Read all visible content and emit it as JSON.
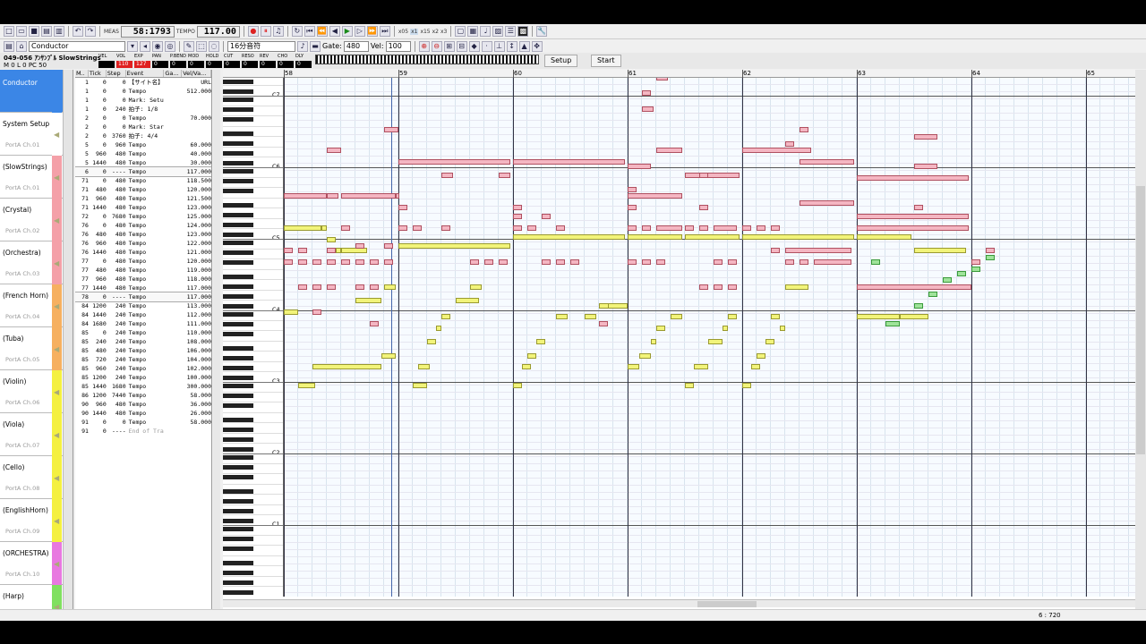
{
  "toolbar": {
    "meas_label": "MEAS",
    "meas": "58:1793",
    "tempo_label": "TEMPO",
    "tempo": "117.00",
    "zoom_labels": [
      "x05",
      "x1",
      "x15",
      "x2",
      "x3"
    ]
  },
  "toolbar2": {
    "track_select": "Conductor",
    "quant": "16分音符",
    "gate_label": "Gate:",
    "gate": "480",
    "vel_label": "Vel:",
    "vel": "100"
  },
  "trackbar": {
    "name": "049-056 ｱﾝｻﾝﾌﾞﾙ SlowStrings",
    "mixer": [
      "VEL",
      "VOL",
      "EXP",
      "PAN",
      "P.BEND",
      "MOD",
      "HOLD",
      "CUT",
      "RESO",
      "REV",
      "CHO",
      "DLY"
    ],
    "mixer_values": [
      "",
      "110",
      "127",
      "0",
      "0",
      "0",
      "0",
      "0",
      "0",
      "0",
      "0",
      "0"
    ],
    "m_label": "M",
    "m": "0",
    "l_label": "L",
    "l": "0",
    "pc_label": "PC",
    "pc": "50",
    "setup": "Setup",
    "start": "Start"
  },
  "tracks": [
    {
      "name": "Conductor",
      "port": "",
      "color": "#3b86e6"
    },
    {
      "name": "System Setup",
      "port": "PortA  Ch.01",
      "color": "#ffffff"
    },
    {
      "name": "(SlowStrings)",
      "port": "PortA  Ch.01",
      "color": "#f4a0a8"
    },
    {
      "name": "(Crystal)",
      "port": "PortA  Ch.02",
      "color": "#f4a0a8"
    },
    {
      "name": "(Orchestra)",
      "port": "PortA  Ch.03",
      "color": "#f4a0a8"
    },
    {
      "name": "(French Horn)",
      "port": "PortA  Ch.04",
      "color": "#f6b060"
    },
    {
      "name": "(Tuba)",
      "port": "PortA  Ch.05",
      "color": "#f6b060"
    },
    {
      "name": "(Violin)",
      "port": "PortA  Ch.06",
      "color": "#f4f040"
    },
    {
      "name": "(Viola)",
      "port": "PortA  Ch.07",
      "color": "#f4f040"
    },
    {
      "name": "(Cello)",
      "port": "PortA  Ch.08",
      "color": "#f4f040"
    },
    {
      "name": "(EnglishHorn)",
      "port": "PortA  Ch.09",
      "color": "#f4f040"
    },
    {
      "name": "(ORCHESTRA)",
      "port": "PortA  Ch.10",
      "color": "#e878e0"
    },
    {
      "name": "(Harp)",
      "port": "",
      "color": "#80e060"
    }
  ],
  "evlist": {
    "headers": [
      "M..",
      "Tick",
      "Step",
      "Event",
      "Ga...",
      "Vel/Va..."
    ],
    "rows": [
      [
        "1",
        "0",
        "0",
        "【サイト名】",
        "URL"
      ],
      [
        "1",
        "0",
        "0",
        "Tempo",
        "512.000"
      ],
      [
        "1",
        "0",
        "0",
        "Mark: Setup",
        ""
      ],
      [
        "1",
        "0",
        "240",
        "拍子: 1/8",
        ""
      ],
      [
        "2",
        "0",
        "0",
        "Tempo",
        "70.000"
      ],
      [
        "2",
        "0",
        "0",
        "Mark: Start",
        ""
      ],
      [
        "2",
        "0",
        "3760",
        "拍子: 4/4",
        ""
      ],
      [
        "5",
        "0",
        "960",
        "Tempo",
        "60.000"
      ],
      [
        "5",
        "960",
        "480",
        "Tempo",
        "40.000"
      ],
      [
        "5",
        "1440",
        "480",
        "Tempo",
        "30.000"
      ],
      [
        "6",
        "0",
        "----",
        "Tempo",
        "117.000"
      ],
      [
        "71",
        "0",
        "480",
        "Tempo",
        "118.500"
      ],
      [
        "71",
        "480",
        "480",
        "Tempo",
        "120.000"
      ],
      [
        "71",
        "960",
        "480",
        "Tempo",
        "121.500"
      ],
      [
        "71",
        "1440",
        "480",
        "Tempo",
        "123.000"
      ],
      [
        "72",
        "0",
        "7680",
        "Tempo",
        "125.000"
      ],
      [
        "76",
        "0",
        "480",
        "Tempo",
        "124.000"
      ],
      [
        "76",
        "480",
        "480",
        "Tempo",
        "123.000"
      ],
      [
        "76",
        "960",
        "480",
        "Tempo",
        "122.000"
      ],
      [
        "76",
        "1440",
        "480",
        "Tempo",
        "121.000"
      ],
      [
        "77",
        "0",
        "480",
        "Tempo",
        "120.000"
      ],
      [
        "77",
        "480",
        "480",
        "Tempo",
        "119.000"
      ],
      [
        "77",
        "960",
        "480",
        "Tempo",
        "118.000"
      ],
      [
        "77",
        "1440",
        "480",
        "Tempo",
        "117.000"
      ],
      [
        "78",
        "0",
        "----",
        "Tempo",
        "117.000"
      ],
      [
        "84",
        "1200",
        "240",
        "Tempo",
        "113.000"
      ],
      [
        "84",
        "1440",
        "240",
        "Tempo",
        "112.000"
      ],
      [
        "84",
        "1680",
        "240",
        "Tempo",
        "111.000"
      ],
      [
        "85",
        "0",
        "240",
        "Tempo",
        "110.000"
      ],
      [
        "85",
        "240",
        "240",
        "Tempo",
        "108.000"
      ],
      [
        "85",
        "480",
        "240",
        "Tempo",
        "106.000"
      ],
      [
        "85",
        "720",
        "240",
        "Tempo",
        "104.000"
      ],
      [
        "85",
        "960",
        "240",
        "Tempo",
        "102.000"
      ],
      [
        "85",
        "1200",
        "240",
        "Tempo",
        "100.000"
      ],
      [
        "85",
        "1440",
        "1680",
        "Tempo",
        "300.000"
      ],
      [
        "86",
        "1200",
        "7440",
        "Tempo",
        "58.000"
      ],
      [
        "90",
        "960",
        "480",
        "Tempo",
        "36.000"
      ],
      [
        "90",
        "1440",
        "480",
        "Tempo",
        "26.000"
      ],
      [
        "91",
        "0",
        "0",
        "Tempo",
        "58.000"
      ],
      [
        "91",
        "0",
        "----",
        "End of Track",
        ""
      ]
    ]
  },
  "roll": {
    "measures": [
      "58",
      "59",
      "60",
      "61",
      "62",
      "63",
      "64",
      "65"
    ],
    "octaves": [
      "C7",
      "C6",
      "C5",
      "C4",
      "C3",
      "C2",
      "C1"
    ]
  },
  "notes": [
    [
      1.0,
      2.2,
      216,
      "y"
    ],
    [
      2.0,
      6.8,
      208,
      "y"
    ],
    [
      6.8,
      7.8,
      203,
      "y"
    ],
    [
      0.0,
      1.0,
      184,
      "y"
    ],
    [
      2.0,
      2.6,
      184,
      "p"
    ],
    [
      6.0,
      6.6,
      189,
      "p"
    ],
    [
      5.0,
      6.8,
      179,
      "y"
    ],
    [
      1.0,
      1.6,
      173,
      "p"
    ],
    [
      2.0,
      2.6,
      173,
      "p"
    ],
    [
      3.0,
      3.6,
      173,
      "p"
    ],
    [
      5.0,
      5.6,
      173,
      "p"
    ],
    [
      6.0,
      6.6,
      173,
      "p"
    ],
    [
      7.0,
      7.8,
      173,
      "y"
    ],
    [
      0.0,
      0.6,
      162,
      "p"
    ],
    [
      1.0,
      1.6,
      162,
      "p"
    ],
    [
      2.0,
      2.6,
      162,
      "p"
    ],
    [
      3.0,
      3.6,
      162,
      "p"
    ],
    [
      4.0,
      4.6,
      162,
      "p"
    ],
    [
      5.0,
      5.6,
      162,
      "p"
    ],
    [
      6.0,
      6.6,
      162,
      "p"
    ],
    [
      7.0,
      7.6,
      162,
      "p"
    ],
    [
      0.0,
      0.6,
      157,
      "p"
    ],
    [
      1.0,
      1.6,
      157,
      "p"
    ],
    [
      3.0,
      3.6,
      157,
      "p"
    ],
    [
      3.6,
      4.0,
      157,
      "y"
    ],
    [
      4.0,
      5.8,
      157,
      "y"
    ],
    [
      5.0,
      5.6,
      155,
      "p"
    ],
    [
      7.0,
      7.6,
      155,
      "p"
    ],
    [
      3.0,
      3.6,
      152,
      "y"
    ],
    [
      0.0,
      2.6,
      147,
      "y"
    ],
    [
      2.6,
      3.0,
      147,
      "y"
    ],
    [
      4.0,
      4.6,
      147,
      "p"
    ],
    [
      0.0,
      3.0,
      133,
      "p"
    ],
    [
      3.0,
      3.8,
      133,
      "p"
    ],
    [
      4.0,
      7.8,
      133,
      "p"
    ],
    [
      7.8,
      8.0,
      133,
      "p"
    ],
    [
      3.0,
      4.0,
      113,
      "p"
    ],
    [
      7.0,
      8.0,
      104,
      "p"
    ],
    [
      9.0,
      10.0,
      216,
      "y"
    ],
    [
      9.4,
      10.2,
      208,
      "y"
    ],
    [
      10.0,
      10.6,
      197,
      "y"
    ],
    [
      10.6,
      11.0,
      191,
      "y"
    ],
    [
      11.0,
      11.6,
      186,
      "y"
    ],
    [
      12.0,
      13.6,
      179,
      "y"
    ],
    [
      13.0,
      13.8,
      173,
      "y"
    ],
    [
      13.0,
      13.6,
      162,
      "p"
    ],
    [
      14.0,
      14.6,
      162,
      "p"
    ],
    [
      15.0,
      15.6,
      162,
      "p"
    ],
    [
      8.0,
      15.8,
      155,
      "y"
    ],
    [
      8.0,
      8.6,
      147,
      "p"
    ],
    [
      9.0,
      9.6,
      147,
      "p"
    ],
    [
      11.0,
      11.6,
      147,
      "p"
    ],
    [
      8.0,
      8.6,
      138,
      "p"
    ],
    [
      8.0,
      15.8,
      118,
      "p"
    ],
    [
      11.0,
      11.8,
      124,
      "p"
    ],
    [
      15.0,
      15.8,
      124,
      "p"
    ],
    [
      16.0,
      16.6,
      216,
      "y"
    ],
    [
      16.6,
      17.2,
      208,
      "y"
    ],
    [
      17.0,
      17.6,
      203,
      "y"
    ],
    [
      17.6,
      18.2,
      197,
      "y"
    ],
    [
      19.0,
      19.8,
      186,
      "y"
    ],
    [
      18.0,
      18.6,
      162,
      "p"
    ],
    [
      19.0,
      19.6,
      162,
      "p"
    ],
    [
      20.0,
      20.6,
      162,
      "p"
    ],
    [
      16.0,
      16.6,
      147,
      "p"
    ],
    [
      17.0,
      17.6,
      147,
      "p"
    ],
    [
      19.0,
      19.6,
      147,
      "p"
    ],
    [
      16.0,
      16.6,
      142,
      "p"
    ],
    [
      18.0,
      18.6,
      142,
      "p"
    ],
    [
      16.0,
      16.6,
      138,
      "p"
    ],
    [
      16.0,
      23.8,
      151,
      "y"
    ],
    [
      16.0,
      23.8,
      118,
      "p"
    ],
    [
      21.0,
      21.8,
      186,
      "y"
    ],
    [
      22.0,
      22.6,
      189,
      "p"
    ],
    [
      22.0,
      22.8,
      181,
      "y"
    ],
    [
      22.6,
      24.0,
      181,
      "y"
    ],
    [
      24.0,
      24.8,
      208,
      "y"
    ],
    [
      24.8,
      25.6,
      203,
      "y"
    ],
    [
      25.6,
      26.0,
      197,
      "y"
    ],
    [
      26.0,
      26.6,
      191,
      "y"
    ],
    [
      27.0,
      27.8,
      186,
      "y"
    ],
    [
      24.0,
      24.6,
      162,
      "p"
    ],
    [
      25.0,
      25.6,
      162,
      "p"
    ],
    [
      26.0,
      26.6,
      162,
      "p"
    ],
    [
      24.0,
      24.6,
      147,
      "p"
    ],
    [
      25.0,
      25.6,
      147,
      "p"
    ],
    [
      26.0,
      27.8,
      147,
      "p"
    ],
    [
      24.0,
      27.8,
      151,
      "y"
    ],
    [
      24.0,
      27.8,
      133,
      "p"
    ],
    [
      24.0,
      24.6,
      138,
      "p"
    ],
    [
      24.0,
      24.6,
      130,
      "p"
    ],
    [
      24.0,
      25.6,
      120,
      "p"
    ],
    [
      26.0,
      27.8,
      113,
      "p"
    ],
    [
      25.0,
      25.8,
      95,
      "p"
    ],
    [
      25.0,
      25.6,
      88,
      "p"
    ],
    [
      26.0,
      26.8,
      81,
      "p"
    ],
    [
      27.0,
      27.8,
      78,
      "p"
    ],
    [
      28.0,
      28.6,
      216,
      "y"
    ],
    [
      28.6,
      29.6,
      208,
      "y"
    ],
    [
      29.6,
      30.6,
      197,
      "y"
    ],
    [
      30.6,
      31.0,
      191,
      "y"
    ],
    [
      31.0,
      31.6,
      186,
      "y"
    ],
    [
      29.0,
      29.6,
      173,
      "p"
    ],
    [
      30.0,
      30.6,
      173,
      "p"
    ],
    [
      31.0,
      31.6,
      173,
      "p"
    ],
    [
      30.0,
      30.6,
      162,
      "p"
    ],
    [
      31.0,
      31.6,
      162,
      "p"
    ],
    [
      28.0,
      28.6,
      147,
      "p"
    ],
    [
      29.0,
      29.6,
      147,
      "p"
    ],
    [
      30.0,
      31.6,
      147,
      "p"
    ],
    [
      28.0,
      31.8,
      151,
      "y"
    ],
    [
      28.0,
      31.8,
      124,
      "p"
    ],
    [
      29.0,
      29.6,
      138,
      "p"
    ],
    [
      29.0,
      29.6,
      124,
      "p"
    ],
    [
      32.0,
      32.6,
      216,
      "y"
    ],
    [
      32.6,
      33.2,
      208,
      "y"
    ],
    [
      33.0,
      33.6,
      203,
      "y"
    ],
    [
      33.6,
      34.2,
      197,
      "y"
    ],
    [
      34.0,
      34.6,
      186,
      "y"
    ],
    [
      34.6,
      35.0,
      191,
      "y"
    ],
    [
      35.0,
      36.6,
      173,
      "y"
    ],
    [
      35.0,
      35.6,
      162,
      "p"
    ],
    [
      36.0,
      36.6,
      162,
      "p"
    ],
    [
      37.0,
      39.6,
      162,
      "p"
    ],
    [
      34.0,
      34.6,
      157,
      "p"
    ],
    [
      35.0,
      39.6,
      157,
      "p"
    ],
    [
      32.0,
      39.8,
      151,
      "y"
    ],
    [
      36.0,
      39.8,
      136,
      "p"
    ],
    [
      32.0,
      32.6,
      147,
      "p"
    ],
    [
      33.0,
      33.6,
      147,
      "p"
    ],
    [
      34.0,
      34.6,
      147,
      "p"
    ],
    [
      32.0,
      36.8,
      113,
      "p"
    ],
    [
      36.0,
      39.8,
      118,
      "p"
    ],
    [
      35.0,
      35.6,
      110,
      "p"
    ],
    [
      36.0,
      36.6,
      104,
      "p"
    ],
    [
      40.0,
      43.0,
      186,
      "y"
    ],
    [
      42.0,
      43.0,
      189,
      "g"
    ],
    [
      43.0,
      45.0,
      186,
      "y"
    ],
    [
      44.0,
      44.6,
      181,
      "g"
    ],
    [
      45.0,
      45.6,
      176,
      "g"
    ],
    [
      46.0,
      46.6,
      170,
      "g"
    ],
    [
      47.0,
      47.6,
      167,
      "g"
    ],
    [
      48.0,
      48.6,
      165,
      "g"
    ],
    [
      49.0,
      49.6,
      160,
      "g"
    ],
    [
      40.0,
      48.0,
      173,
      "p"
    ],
    [
      41.0,
      41.6,
      162,
      "g"
    ],
    [
      48.0,
      48.6,
      162,
      "p"
    ],
    [
      49.0,
      49.6,
      157,
      "p"
    ],
    [
      40.0,
      43.8,
      151,
      "y"
    ],
    [
      44.0,
      47.6,
      157,
      "y"
    ],
    [
      40.0,
      47.8,
      147,
      "p"
    ],
    [
      40.0,
      47.8,
      142,
      "p"
    ],
    [
      44.0,
      44.6,
      138,
      "p"
    ],
    [
      40.0,
      47.8,
      125,
      "p"
    ],
    [
      44.0,
      45.6,
      120,
      "p"
    ],
    [
      44.0,
      45.6,
      107,
      "p"
    ]
  ]
}
